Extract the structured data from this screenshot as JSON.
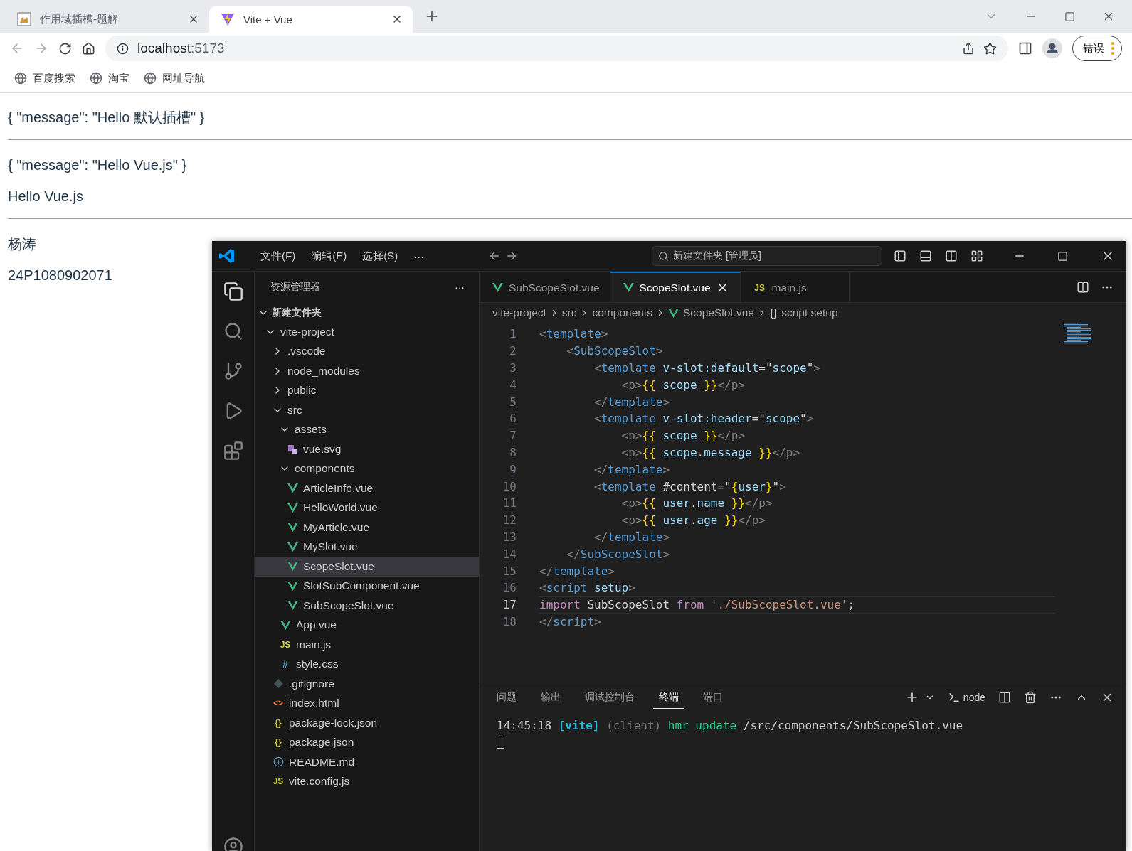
{
  "browser": {
    "tabs": [
      {
        "title": "作用域插槽-题解",
        "kind": "cat",
        "selected": false
      },
      {
        "title": "Vite + Vue",
        "kind": "vite",
        "selected": true
      }
    ],
    "address": {
      "host": "localhost",
      "port": ":5173"
    },
    "profile_button": "错误",
    "bookmarks": [
      "百度搜索",
      "淘宝",
      "网址导航"
    ]
  },
  "page": {
    "blocks": [
      {
        "kind": "text",
        "text": "{ \"message\": \"Hello 默认插槽\" }"
      },
      {
        "kind": "rule"
      },
      {
        "kind": "text",
        "text": "{ \"message\": \"Hello Vue.js\" }"
      },
      {
        "kind": "text",
        "text": "Hello Vue.js"
      },
      {
        "kind": "rule"
      },
      {
        "kind": "text",
        "text": "杨涛"
      },
      {
        "kind": "text",
        "text": "24P1080902071"
      }
    ]
  },
  "editor_window": {
    "menu": [
      "文件(F)",
      "编辑(E)",
      "选择(S)",
      "···"
    ],
    "search": "新建文件夹 [管理员]",
    "explorer": {
      "title": "资源管理器",
      "more": "···",
      "root": "新建文件夹",
      "tree": [
        {
          "name": "vite-project",
          "kind": "folder",
          "expanded": true,
          "selected": false,
          "children": [
            {
              "name": ".vscode",
              "kind": "folder",
              "expanded": false,
              "selected": false
            },
            {
              "name": "node_modules",
              "kind": "folder",
              "expanded": false,
              "selected": false
            },
            {
              "name": "public",
              "kind": "folder",
              "expanded": false,
              "selected": false
            },
            {
              "name": "src",
              "kind": "folder",
              "expanded": true,
              "selected": false,
              "children": [
                {
                  "name": "assets",
                  "kind": "folder",
                  "expanded": true,
                  "selected": false,
                  "children": [
                    {
                      "name": "vue.svg",
                      "kind": "svg",
                      "selected": false
                    }
                  ]
                },
                {
                  "name": "components",
                  "kind": "folder",
                  "expanded": true,
                  "selected": false,
                  "children": [
                    {
                      "name": "ArticleInfo.vue",
                      "kind": "vue",
                      "selected": false
                    },
                    {
                      "name": "HelloWorld.vue",
                      "kind": "vue",
                      "selected": false
                    },
                    {
                      "name": "MyArticle.vue",
                      "kind": "vue",
                      "selected": false
                    },
                    {
                      "name": "MySlot.vue",
                      "kind": "vue",
                      "selected": false
                    },
                    {
                      "name": "ScopeSlot.vue",
                      "kind": "vue",
                      "selected": true
                    },
                    {
                      "name": "SlotSubComponent.vue",
                      "kind": "vue",
                      "selected": false
                    },
                    {
                      "name": "SubScopeSlot.vue",
                      "kind": "vue",
                      "selected": false
                    }
                  ]
                },
                {
                  "name": "App.vue",
                  "kind": "vue",
                  "selected": false
                },
                {
                  "name": "main.js",
                  "kind": "js",
                  "glyph": "JS",
                  "selected": false
                },
                {
                  "name": "style.css",
                  "kind": "css",
                  "glyph": "#",
                  "selected": false
                }
              ]
            },
            {
              "name": ".gitignore",
              "kind": "git",
              "selected": false
            },
            {
              "name": "index.html",
              "kind": "html",
              "glyph": "<>",
              "selected": false
            },
            {
              "name": "package-lock.json",
              "kind": "json",
              "glyph": "{}",
              "selected": false
            },
            {
              "name": "package.json",
              "kind": "json",
              "glyph": "{}",
              "selected": false
            },
            {
              "name": "README.md",
              "kind": "info",
              "selected": false
            },
            {
              "name": "vite.config.js",
              "kind": "js",
              "glyph": "JS",
              "selected": false
            }
          ]
        }
      ]
    },
    "tabs": [
      {
        "name": "SubScopeSlot.vue",
        "kind": "vue",
        "selected": false
      },
      {
        "name": "ScopeSlot.vue",
        "kind": "vue",
        "selected": true
      },
      {
        "name": "main.js",
        "kind": "js",
        "glyph": "JS",
        "selected": false
      }
    ],
    "breadcrumb": [
      {
        "text": "vite-project"
      },
      {
        "text": "src"
      },
      {
        "text": "components"
      },
      {
        "text": "ScopeSlot.vue",
        "kind": "vue"
      },
      {
        "text": "script setup",
        "glyph": "{}"
      }
    ],
    "code": [
      {
        "number": "1",
        "current": false,
        "tokens": [
          {
            "kind": "punct",
            "text": "<"
          },
          {
            "kind": "tag",
            "text": "template"
          },
          {
            "kind": "punct",
            "text": ">"
          }
        ]
      },
      {
        "number": "2",
        "current": false,
        "tokens": [
          {
            "kind": "punct",
            "text": "    <"
          },
          {
            "kind": "tag",
            "text": "SubScopeSlot"
          },
          {
            "kind": "punct",
            "text": ">"
          }
        ]
      },
      {
        "number": "3",
        "current": false,
        "tokens": [
          {
            "kind": "punct",
            "text": "        <"
          },
          {
            "kind": "tag",
            "text": "template"
          },
          {
            "kind": "attr",
            "text": " v-slot:default"
          },
          {
            "kind": "plain",
            "text": "=\""
          },
          {
            "kind": "var",
            "text": "scope"
          },
          {
            "kind": "plain",
            "text": "\""
          },
          {
            "kind": "punct",
            "text": ">"
          }
        ]
      },
      {
        "number": "4",
        "current": false,
        "tokens": [
          {
            "kind": "punct",
            "text": "            <p>"
          },
          {
            "kind": "brace",
            "text": "{{"
          },
          {
            "kind": "var",
            "text": " scope "
          },
          {
            "kind": "brace",
            "text": "}}"
          },
          {
            "kind": "punct",
            "text": "</p>"
          }
        ]
      },
      {
        "number": "5",
        "current": false,
        "tokens": [
          {
            "kind": "punct",
            "text": "        </"
          },
          {
            "kind": "tag",
            "text": "template"
          },
          {
            "kind": "punct",
            "text": ">"
          }
        ]
      },
      {
        "number": "6",
        "current": false,
        "tokens": [
          {
            "kind": "punct",
            "text": "        <"
          },
          {
            "kind": "tag",
            "text": "template"
          },
          {
            "kind": "attr",
            "text": " v-slot:header"
          },
          {
            "kind": "plain",
            "text": "=\""
          },
          {
            "kind": "var",
            "text": "scope"
          },
          {
            "kind": "plain",
            "text": "\""
          },
          {
            "kind": "punct",
            "text": ">"
          }
        ]
      },
      {
        "number": "7",
        "current": false,
        "tokens": [
          {
            "kind": "punct",
            "text": "            <p>"
          },
          {
            "kind": "brace",
            "text": "{{"
          },
          {
            "kind": "var",
            "text": " scope "
          },
          {
            "kind": "brace",
            "text": "}}"
          },
          {
            "kind": "punct",
            "text": "</p>"
          }
        ]
      },
      {
        "number": "8",
        "current": false,
        "tokens": [
          {
            "kind": "punct",
            "text": "            <p>"
          },
          {
            "kind": "brace",
            "text": "{{"
          },
          {
            "kind": "var",
            "text": " scope"
          },
          {
            "kind": "plain",
            "text": "."
          },
          {
            "kind": "var",
            "text": "message "
          },
          {
            "kind": "brace",
            "text": "}}"
          },
          {
            "kind": "punct",
            "text": "</p>"
          }
        ]
      },
      {
        "number": "9",
        "current": false,
        "tokens": [
          {
            "kind": "punct",
            "text": "        </"
          },
          {
            "kind": "tag",
            "text": "template"
          },
          {
            "kind": "punct",
            "text": ">"
          }
        ]
      },
      {
        "number": "10",
        "current": false,
        "tokens": [
          {
            "kind": "punct",
            "text": "        <"
          },
          {
            "kind": "tag",
            "text": "template"
          },
          {
            "kind": "plain",
            "text": " #content=\""
          },
          {
            "kind": "brace",
            "text": "{"
          },
          {
            "kind": "var",
            "text": "user"
          },
          {
            "kind": "brace",
            "text": "}"
          },
          {
            "kind": "plain",
            "text": "\""
          },
          {
            "kind": "punct",
            "text": ">"
          }
        ]
      },
      {
        "number": "11",
        "current": false,
        "tokens": [
          {
            "kind": "punct",
            "text": "            <p>"
          },
          {
            "kind": "brace",
            "text": "{{"
          },
          {
            "kind": "var",
            "text": " user"
          },
          {
            "kind": "plain",
            "text": "."
          },
          {
            "kind": "var",
            "text": "name "
          },
          {
            "kind": "brace",
            "text": "}}"
          },
          {
            "kind": "punct",
            "text": "</p>"
          }
        ]
      },
      {
        "number": "12",
        "current": false,
        "tokens": [
          {
            "kind": "punct",
            "text": "            <p>"
          },
          {
            "kind": "brace",
            "text": "{{"
          },
          {
            "kind": "var",
            "text": " user"
          },
          {
            "kind": "plain",
            "text": "."
          },
          {
            "kind": "var",
            "text": "age "
          },
          {
            "kind": "brace",
            "text": "}}"
          },
          {
            "kind": "punct",
            "text": "</p>"
          }
        ]
      },
      {
        "number": "13",
        "current": false,
        "tokens": [
          {
            "kind": "punct",
            "text": "        </"
          },
          {
            "kind": "tag",
            "text": "template"
          },
          {
            "kind": "punct",
            "text": ">"
          }
        ]
      },
      {
        "number": "14",
        "current": false,
        "tokens": [
          {
            "kind": "punct",
            "text": "    </"
          },
          {
            "kind": "tag",
            "text": "SubScopeSlot"
          },
          {
            "kind": "punct",
            "text": ">"
          }
        ]
      },
      {
        "number": "15",
        "current": false,
        "tokens": [
          {
            "kind": "punct",
            "text": "</"
          },
          {
            "kind": "tag",
            "text": "template"
          },
          {
            "kind": "punct",
            "text": ">"
          }
        ]
      },
      {
        "number": "16",
        "current": false,
        "tokens": [
          {
            "kind": "punct",
            "text": "<"
          },
          {
            "kind": "tag",
            "text": "script"
          },
          {
            "kind": "attr",
            "text": " setup"
          },
          {
            "kind": "punct",
            "text": ">"
          }
        ]
      },
      {
        "number": "17",
        "current": true,
        "tokens": [
          {
            "kind": "keyword",
            "text": "import"
          },
          {
            "kind": "plain",
            "text": " SubScopeSlot "
          },
          {
            "kind": "keyword",
            "text": "from"
          },
          {
            "kind": "string",
            "text": " './SubScopeSlot.vue'"
          },
          {
            "kind": "plain",
            "text": ";"
          }
        ]
      },
      {
        "number": "18",
        "current": false,
        "tokens": [
          {
            "kind": "punct",
            "text": "</"
          },
          {
            "kind": "tag",
            "text": "script"
          },
          {
            "kind": "punct",
            "text": ">"
          }
        ]
      }
    ],
    "panel": {
      "tabs": [
        {
          "label": "问题",
          "selected": false
        },
        {
          "label": "输出",
          "selected": false
        },
        {
          "label": "调试控制台",
          "selected": false
        },
        {
          "label": "终端",
          "selected": true
        },
        {
          "label": "端口",
          "selected": false
        }
      ],
      "shell": "node",
      "terminal": [
        {
          "kind": "plain",
          "text": "14:45:18 "
        },
        {
          "kind": "vite",
          "text": "[vite]"
        },
        {
          "kind": "dim",
          "text": " (client) "
        },
        {
          "kind": "green",
          "text": "hmr update"
        },
        {
          "kind": "plain",
          "text": " /src/components/SubScopeSlot.vue"
        }
      ]
    }
  }
}
